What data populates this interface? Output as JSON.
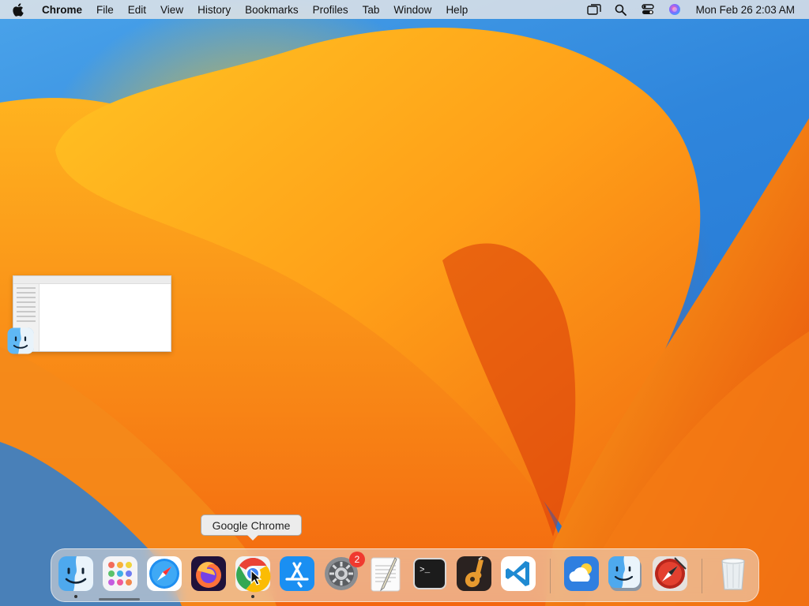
{
  "menubar": {
    "apple_icon": "apple-logo-icon",
    "app_name": "Chrome",
    "menus": [
      "File",
      "Edit",
      "View",
      "History",
      "Bookmarks",
      "Profiles",
      "Tab",
      "Window",
      "Help"
    ],
    "status_icons": [
      "screen-mirroring-icon",
      "spotlight-search-icon",
      "control-center-icon",
      "siri-icon"
    ],
    "clock": "Mon Feb 26  2:03 AM"
  },
  "tooltip": {
    "label": "Google Chrome"
  },
  "dock": {
    "items": [
      {
        "name": "Finder",
        "icon": "finder-icon",
        "running": true
      },
      {
        "name": "Launchpad",
        "icon": "launchpad-icon",
        "running": false
      },
      {
        "name": "Safari",
        "icon": "safari-icon",
        "running": false
      },
      {
        "name": "Firefox",
        "icon": "firefox-icon",
        "running": false
      },
      {
        "name": "Google Chrome",
        "icon": "chrome-icon",
        "running": true
      },
      {
        "name": "App Store",
        "icon": "app-store-icon",
        "running": false
      },
      {
        "name": "System Settings",
        "icon": "system-settings-icon",
        "running": false,
        "badge": "2"
      },
      {
        "name": "TextEdit",
        "icon": "textedit-icon",
        "running": false
      },
      {
        "name": "Terminal",
        "icon": "terminal-icon",
        "running": false
      },
      {
        "name": "GarageBand",
        "icon": "garageband-icon",
        "running": false
      },
      {
        "name": "Visual Studio Code",
        "icon": "vscode-icon",
        "running": false
      },
      {
        "name": "Weather",
        "icon": "weather-icon",
        "running": false
      },
      {
        "name": "Finder (folder)",
        "icon": "finder-stack-icon",
        "running": false
      },
      {
        "name": "Safari Technology Preview",
        "icon": "compass-icon",
        "running": false
      },
      {
        "name": "Trash",
        "icon": "trash-icon",
        "running": false
      }
    ],
    "terminal_glyph": ">_"
  },
  "colors": {
    "wallpaper_orange": "#f7931e",
    "wallpaper_blue": "#2f86dc",
    "badge_red": "#f03a2f"
  }
}
